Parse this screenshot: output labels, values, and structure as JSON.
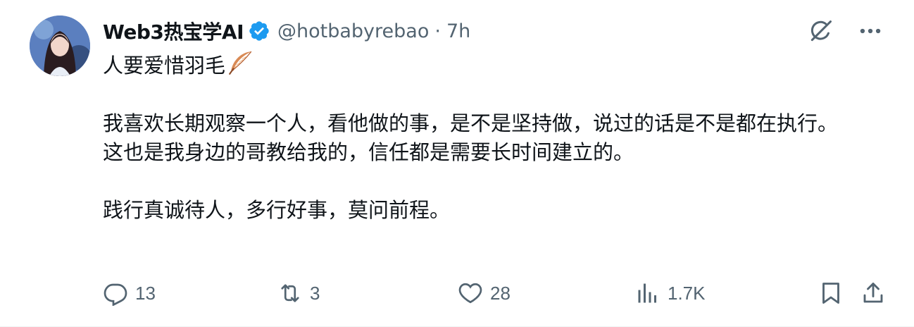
{
  "author": {
    "display_name": "Web3热宝学AI",
    "handle": "@hotbabyrebao",
    "separator": "·",
    "time": "7h",
    "verified": true
  },
  "tweet": {
    "line1": "人要爱惜羽毛",
    "paragraph2": "我喜欢长期观察一个人，看他做的事，是不是坚持做，说过的话是不是都在执行。\n这也是我身边的哥教给我的，信任都是需要长时间建立的。",
    "paragraph3": "践行真诚待人，多行好事，莫问前程。"
  },
  "actions": {
    "replies": "13",
    "retweets": "3",
    "likes": "28",
    "views": "1.7K"
  },
  "icons": {
    "verified": "verified-badge-icon",
    "grok": "grok-icon",
    "more": "more-icon",
    "reply": "reply-icon",
    "retweet": "retweet-icon",
    "like": "heart-icon",
    "views": "views-icon",
    "bookmark": "bookmark-icon",
    "share": "share-icon"
  },
  "colors": {
    "text": "#0f1419",
    "secondary": "#536471",
    "verified": "#1d9bf0"
  }
}
